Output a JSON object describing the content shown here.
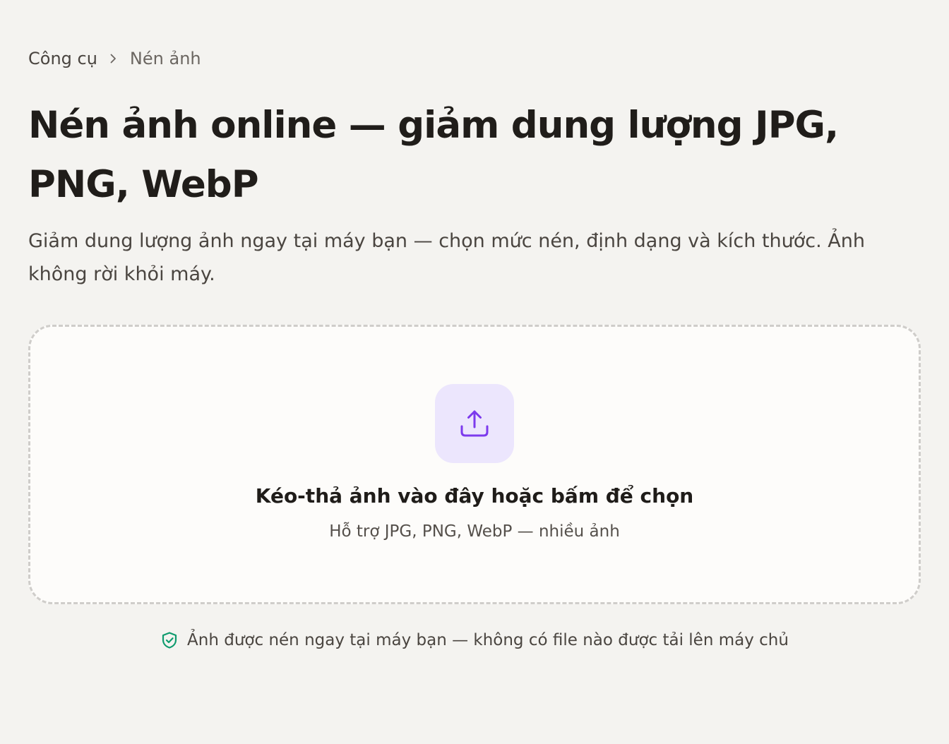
{
  "breadcrumb": {
    "parent": "Công cụ",
    "current": "Nén ảnh",
    "separator_icon": "chevron-right-icon"
  },
  "heading": {
    "title": "Nén ảnh online — giảm dung lượng JPG, PNG, WebP",
    "subtitle": "Giảm dung lượng ảnh ngay tại máy bạn — chọn mức nén, định dạng và kích thước. Ảnh không rời khỏi máy."
  },
  "dropzone": {
    "icon": "upload-icon",
    "title": "Kéo-thả ảnh vào đây hoặc bấm để chọn",
    "hint": "Hỗ trợ JPG, PNG, WebP — nhiều ảnh"
  },
  "privacy": {
    "icon": "shield-check-icon",
    "text": "Ảnh được nén ngay tại máy bạn — không có file nào được tải lên máy chủ"
  },
  "colors": {
    "background": "#f4f3f0",
    "accent": "#7c3aed",
    "accent_tile": "#ece6fd",
    "success": "#0f9b6e"
  }
}
